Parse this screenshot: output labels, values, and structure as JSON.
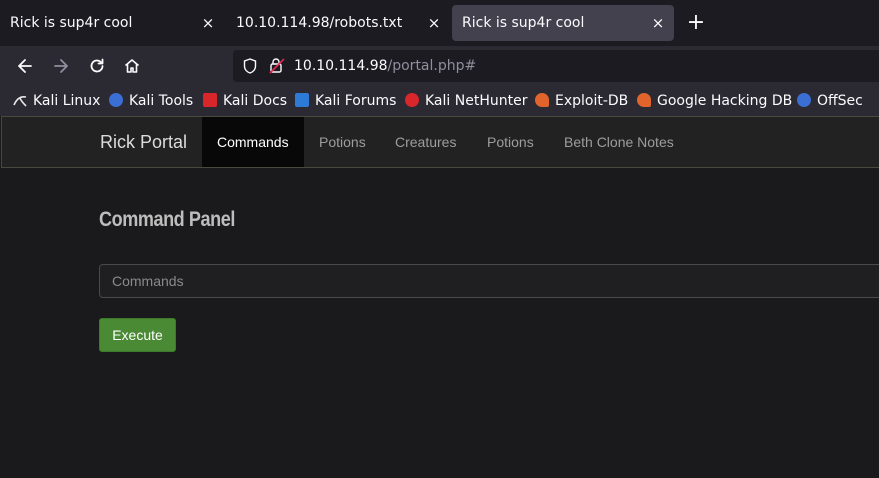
{
  "tabs": [
    {
      "title": "Rick is sup4r cool",
      "active": false
    },
    {
      "title": "10.10.114.98/robots.txt",
      "active": false
    },
    {
      "title": "Rick is sup4r cool",
      "active": true
    }
  ],
  "tab_close_glyph": "×",
  "new_tab_glyph": "+",
  "toolbar": {
    "back_icon": "arrow-left-icon",
    "forward_icon": "arrow-right-icon",
    "reload_icon": "reload-icon",
    "home_icon": "home-icon"
  },
  "url": {
    "host": "10.10.114.98",
    "path": "/portal.php#"
  },
  "bookmarks": [
    {
      "label": "Kali Linux",
      "icon": "kali-dragon-icon",
      "color": "#e8e8e8"
    },
    {
      "label": "Kali Tools",
      "icon": "kali-tools-icon",
      "color": "#3b6fd4"
    },
    {
      "label": "Kali Docs",
      "icon": "kali-docs-icon",
      "color": "#d8262b"
    },
    {
      "label": "Kali Forums",
      "icon": "kali-forums-icon",
      "color": "#2e7bd6"
    },
    {
      "label": "Kali NetHunter",
      "icon": "kali-nethunter-icon",
      "color": "#d8262b"
    },
    {
      "label": "Exploit-DB",
      "icon": "exploit-db-icon",
      "color": "#e0642b"
    },
    {
      "label": "Google Hacking DB",
      "icon": "ghdb-icon",
      "color": "#e0642b"
    },
    {
      "label": "OffSec",
      "icon": "offsec-icon",
      "color": "#3b6fd4"
    }
  ],
  "site": {
    "brand": "Rick Portal",
    "nav": [
      {
        "label": "Commands",
        "active": true
      },
      {
        "label": "Potions",
        "active": false
      },
      {
        "label": "Creatures",
        "active": false
      },
      {
        "label": "Potions",
        "active": false
      },
      {
        "label": "Beth Clone Notes",
        "active": false
      }
    ],
    "panel_title": "Command Panel",
    "command_placeholder": "Commands",
    "execute_label": "Execute"
  },
  "colors": {
    "execute_button": "#4a8a35",
    "nav_active_bg": "#080808"
  }
}
